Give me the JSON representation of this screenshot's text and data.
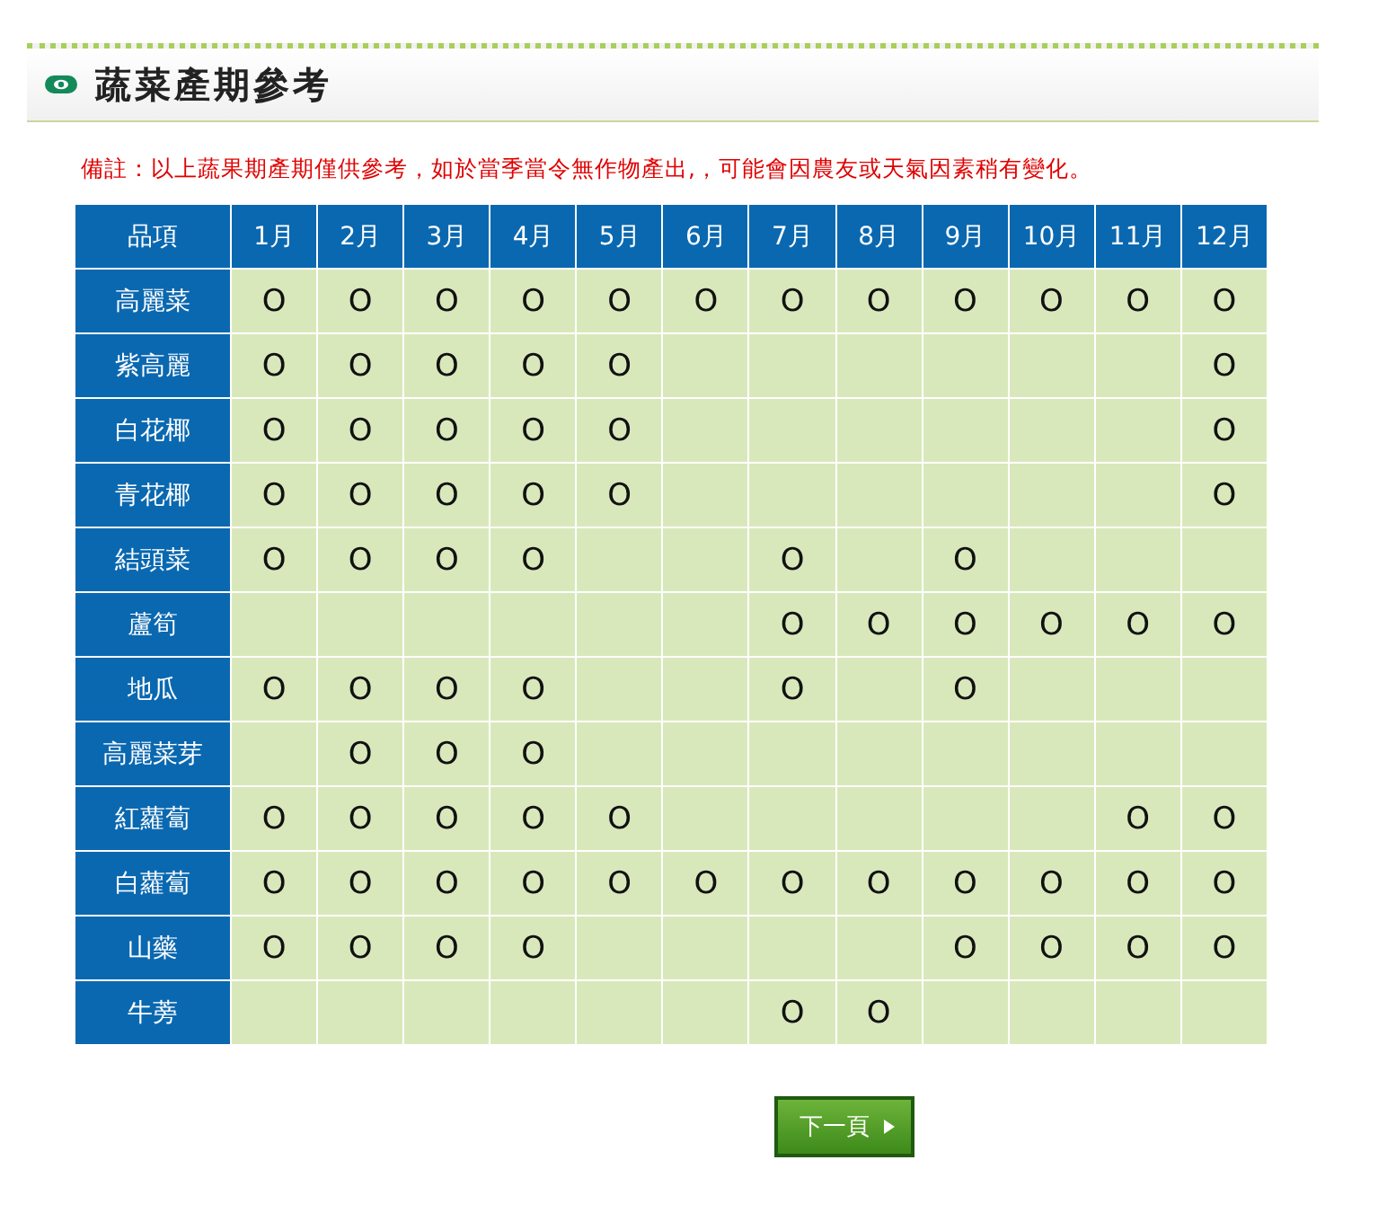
{
  "page_title": "蔬菜產期參考",
  "note": "備註：以上蔬果期產期僅供參考，如於當季當令無作物產出,，可能會因農友或天氣因素稍有變化。",
  "table": {
    "columns": [
      "品項",
      "1月",
      "2月",
      "3月",
      "4月",
      "5月",
      "6月",
      "7月",
      "8月",
      "9月",
      "10月",
      "11月",
      "12月"
    ],
    "rows": [
      {
        "cells": [
          "高麗菜",
          "O",
          "O",
          "O",
          "O",
          "O",
          "O",
          "O",
          "O",
          "O",
          "O",
          "O",
          "O"
        ]
      },
      {
        "cells": [
          "紫高麗",
          "O",
          "O",
          "O",
          "O",
          "O",
          "",
          "",
          "",
          "",
          "",
          "",
          "O"
        ]
      },
      {
        "cells": [
          "白花椰",
          "O",
          "O",
          "O",
          "O",
          "O",
          "",
          "",
          "",
          "",
          "",
          "",
          "O"
        ]
      },
      {
        "cells": [
          "青花椰",
          "O",
          "O",
          "O",
          "O",
          "O",
          "",
          "",
          "",
          "",
          "",
          "",
          "O"
        ]
      },
      {
        "cells": [
          "結頭菜",
          "O",
          "O",
          "O",
          "O",
          "",
          "",
          "O",
          "",
          "O",
          "",
          "",
          ""
        ]
      },
      {
        "cells": [
          "蘆筍",
          "",
          "",
          "",
          "",
          "",
          "",
          "O",
          "O",
          "O",
          "O",
          "O",
          "O"
        ]
      },
      {
        "cells": [
          "地瓜",
          "O",
          "O",
          "O",
          "O",
          "",
          "",
          "O",
          "",
          "O",
          "",
          "",
          ""
        ]
      },
      {
        "cells": [
          "高麗菜芽",
          "",
          "O",
          "O",
          "O",
          "",
          "",
          "",
          "",
          "",
          "",
          "",
          ""
        ]
      },
      {
        "cells": [
          "紅蘿蔔",
          "O",
          "O",
          "O",
          "O",
          "O",
          "",
          "",
          "",
          "",
          "",
          "O",
          "O"
        ]
      },
      {
        "cells": [
          "白蘿蔔",
          "O",
          "O",
          "O",
          "O",
          "O",
          "O",
          "O",
          "O",
          "O",
          "O",
          "O",
          "O"
        ]
      },
      {
        "cells": [
          "山藥",
          "O",
          "O",
          "O",
          "O",
          "",
          "",
          "",
          "",
          "O",
          "O",
          "O",
          "O"
        ]
      },
      {
        "cells": [
          "牛蒡",
          "",
          "",
          "",
          "",
          "",
          "",
          "O",
          "O",
          "",
          "",
          "",
          ""
        ]
      }
    ]
  },
  "next_button": "下一頁"
}
